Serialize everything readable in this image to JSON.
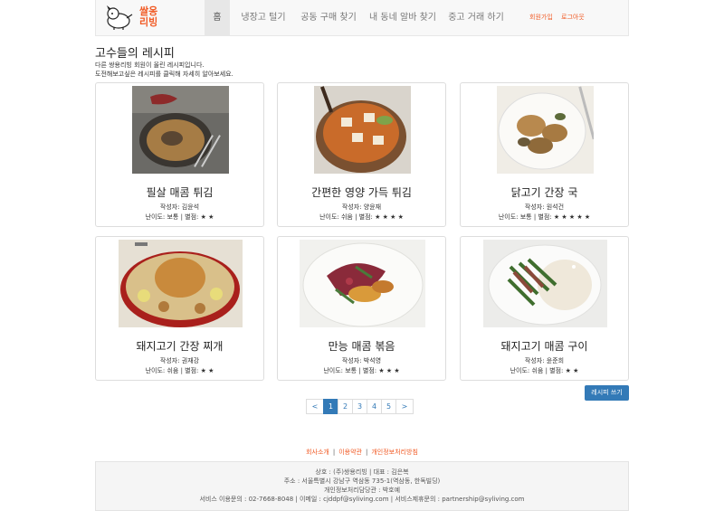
{
  "brand": {
    "logo_text_line1": "쌀옹",
    "logo_text_line2": "리빙"
  },
  "nav": {
    "items": [
      {
        "label": "홈"
      },
      {
        "label": "냉장고 털기"
      },
      {
        "label": "공동 구매 찾기"
      },
      {
        "label": "내 동네 알바 찾기"
      },
      {
        "label": "중고 거래 하기"
      }
    ],
    "signup": "회원가입",
    "logout": "로그아웃"
  },
  "page": {
    "title": "고수들의 레시피",
    "desc_line1": "다른 쌍용리빙 회원이 올린 레시피입니다.",
    "desc_line2": "도전해보고싶은 레시피를 클릭해 자세히 알아보세요."
  },
  "recipes": [
    {
      "title": "필살 매콤 튀김",
      "author": "작성자: 김윤석",
      "meta": "난이도: 보통 | 별점: ★ ★"
    },
    {
      "title": "간편한 영양 가득 튀김",
      "author": "작성자: 양윤재",
      "meta": "난이도: 쉬움 | 별점: ★ ★ ★ ★"
    },
    {
      "title": "닭고기 간장 국",
      "author": "작성자: 원석건",
      "meta": "난이도: 보통 | 별점: ★ ★ ★ ★ ★"
    },
    {
      "title": "돼지고기 간장 찌개",
      "author": "작성자: 권재강",
      "meta": "난이도: 쉬움 | 별점: ★ ★"
    },
    {
      "title": "만능 매콤 볶음",
      "author": "작성자: 박석영",
      "meta": "난이도: 보통 | 별점: ★ ★ ★"
    },
    {
      "title": "돼지고기 매콤 구이",
      "author": "작성자: 윤준희",
      "meta": "난이도: 쉬움 | 별점: ★ ★"
    }
  ],
  "pagination": {
    "prev": "<",
    "pages": [
      "1",
      "2",
      "3",
      "4",
      "5"
    ],
    "next": ">",
    "current": "1"
  },
  "write_button": "레시피 쓰기",
  "footer": {
    "links": [
      "회사소개",
      "이용약관",
      "개인정보처리방침"
    ],
    "line1": "상호 : (주)쌍용리빙 | 대표 : 김은복",
    "line2": "주소 : 서울특별시 강남구 역삼동 735-1(역삼동, 한독빌딩)",
    "line3": "개인정보처리담당관 : 박호예",
    "line4": "서비스 이용문의 : 02-7668-8048 | 이메일 : cjddpf@syliving.com | 서비스제휴문의 : partnership@syliving.com"
  },
  "colors": {
    "accent": "#f15a24",
    "primary": "#337ab7"
  }
}
